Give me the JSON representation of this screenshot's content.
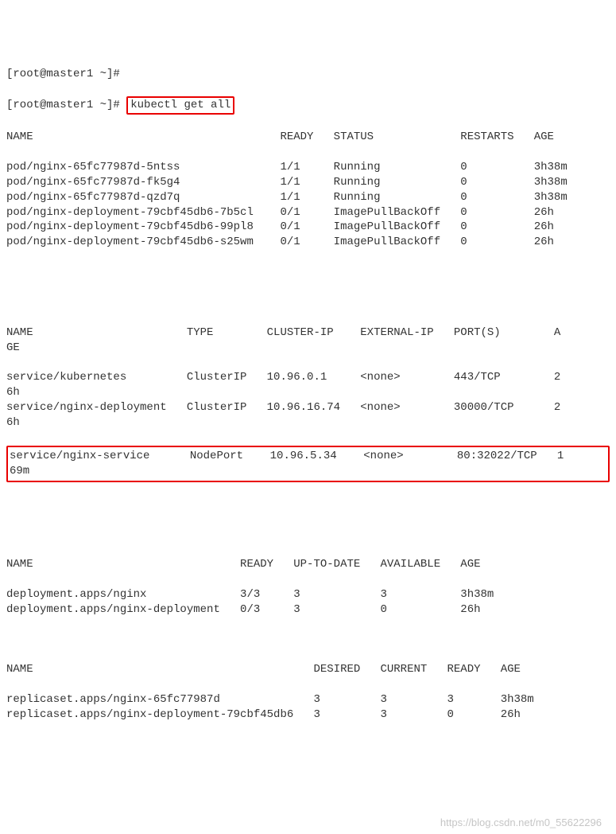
{
  "prompt": {
    "line1": "[root@master1 ~]#",
    "line2_prefix": "[root@master1 ~]# ",
    "command": "kubectl get all"
  },
  "pods": {
    "header": "NAME                                     READY   STATUS             RESTARTS   AGE",
    "rows": [
      {
        "name": "pod/nginx-65fc77987d-5ntss",
        "ready": "1/1",
        "status": "Running",
        "restarts": "0",
        "age": "3h38m"
      },
      {
        "name": "pod/nginx-65fc77987d-fk5g4",
        "ready": "1/1",
        "status": "Running",
        "restarts": "0",
        "age": "3h38m"
      },
      {
        "name": "pod/nginx-65fc77987d-qzd7q",
        "ready": "1/1",
        "status": "Running",
        "restarts": "0",
        "age": "3h38m"
      },
      {
        "name": "pod/nginx-deployment-79cbf45db6-7b5cl",
        "ready": "0/1",
        "status": "ImagePullBackOff",
        "restarts": "0",
        "age": "26h"
      },
      {
        "name": "pod/nginx-deployment-79cbf45db6-99pl8",
        "ready": "0/1",
        "status": "ImagePullBackOff",
        "restarts": "0",
        "age": "26h"
      },
      {
        "name": "pod/nginx-deployment-79cbf45db6-s25wm",
        "ready": "0/1",
        "status": "ImagePullBackOff",
        "restarts": "0",
        "age": "26h"
      }
    ]
  },
  "services": {
    "header": "NAME                       TYPE        CLUSTER-IP    EXTERNAL-IP   PORT(S)        A\nGE",
    "rows": [
      {
        "line": "service/kubernetes         ClusterIP   10.96.0.1     <none>        443/TCP        2\n6h"
      },
      {
        "line": "service/nginx-deployment   ClusterIP   10.96.16.74   <none>        30000/TCP      2\n6h"
      }
    ],
    "highlighted": {
      "line": "service/nginx-service      NodePort    10.96.5.34    <none>        80:32022/TCP   1\n69m"
    }
  },
  "deployments": {
    "header": "NAME                               READY   UP-TO-DATE   AVAILABLE   AGE",
    "rows": [
      {
        "line": "deployment.apps/nginx              3/3     3            3           3h38m"
      },
      {
        "line": "deployment.apps/nginx-deployment   0/3     3            0           26h"
      }
    ]
  },
  "replicasets": {
    "header": "NAME                                          DESIRED   CURRENT   READY   AGE",
    "rows": [
      {
        "line": "replicaset.apps/nginx-65fc77987d              3         3         3       3h38m"
      },
      {
        "line": "replicaset.apps/nginx-deployment-79cbf45db6   3         3         0       26h"
      }
    ]
  },
  "watermark": "https://blog.csdn.net/m0_55622296"
}
